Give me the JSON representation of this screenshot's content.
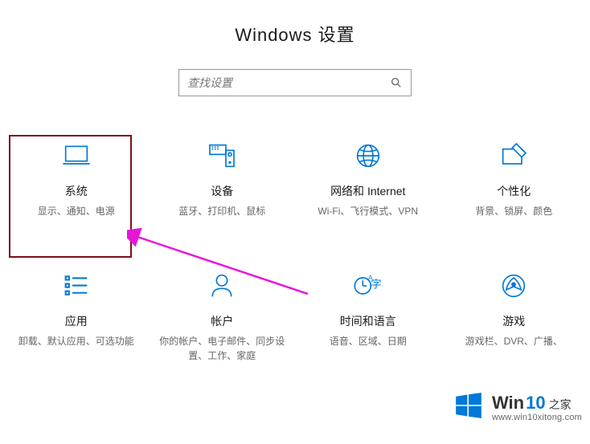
{
  "title": "Windows 设置",
  "search": {
    "placeholder": "查找设置"
  },
  "tiles": {
    "system": {
      "title": "系统",
      "desc": "显示、通知、电源"
    },
    "devices": {
      "title": "设备",
      "desc": "蓝牙、打印机、鼠标"
    },
    "network": {
      "title": "网络和 Internet",
      "desc": "Wi-Fi、飞行模式、VPN"
    },
    "personal": {
      "title": "个性化",
      "desc": "背景、锁屏、颜色"
    },
    "apps": {
      "title": "应用",
      "desc": "卸载、默认应用、可选功能"
    },
    "accounts": {
      "title": "帐户",
      "desc": "你的帐户、电子邮件、同步设置、工作、家庭"
    },
    "timelang": {
      "title": "时间和语言",
      "desc": "语音、区域、日期"
    },
    "gaming": {
      "title": "游戏",
      "desc": "游戏栏、DVR、广播、"
    }
  },
  "watermark": {
    "brand": "Win",
    "num": "10",
    "suffix": "之家",
    "url": "www.win10xitong.com"
  },
  "colors": {
    "accent": "#0078D7",
    "highlight": "#7a0f1a",
    "arrow": "#e815d8"
  }
}
